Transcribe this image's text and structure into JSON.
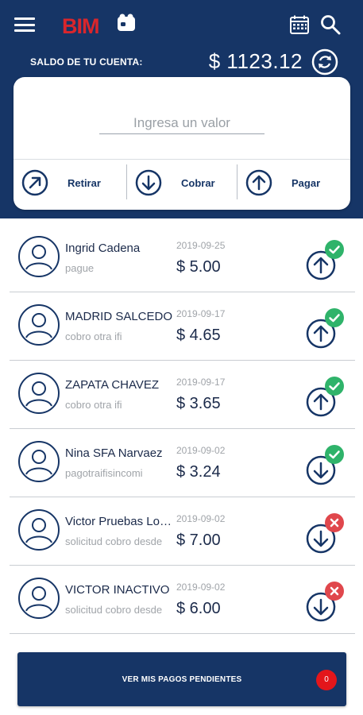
{
  "header": {
    "logo_text": "BIM",
    "balance_label": "SALDO DE TU CUENTA:",
    "balance_value": "$ 1123.12"
  },
  "card": {
    "input_placeholder": "Ingresa un valor",
    "actions": [
      {
        "label": "Retirar",
        "icon": "arrow-up-right-circle-icon"
      },
      {
        "label": "Cobrar",
        "icon": "arrow-down-circle-icon"
      },
      {
        "label": "Pagar",
        "icon": "arrow-up-circle-icon"
      }
    ]
  },
  "transactions": [
    {
      "name": "Ingrid Cadena",
      "description": "pague",
      "date": "2019-09-25",
      "amount": "$ 5.00",
      "direction": "up",
      "status": "success"
    },
    {
      "name": "MADRID SALCEDO",
      "description": "cobro otra ifi",
      "date": "2019-09-17",
      "amount": "$ 4.65",
      "direction": "up",
      "status": "success"
    },
    {
      "name": "ZAPATA CHAVEZ",
      "description": "cobro otra ifi",
      "date": "2019-09-17",
      "amount": "$ 3.65",
      "direction": "up",
      "status": "success"
    },
    {
      "name": "Nina SFA Narvaez",
      "description": "pagotraifisincomi",
      "date": "2019-09-02",
      "amount": "$ 3.24",
      "direction": "down",
      "status": "success"
    },
    {
      "name": "Victor Pruebas Lopez",
      "description": "solicitud cobro desde",
      "date": "2019-09-02",
      "amount": "$ 7.00",
      "direction": "down",
      "status": "failed"
    },
    {
      "name": "VICTOR INACTIVO",
      "description": "solicitud cobro desde",
      "date": "2019-09-02",
      "amount": "$ 6.00",
      "direction": "down",
      "status": "failed"
    }
  ],
  "footer": {
    "pending_label": "VER MIS PAGOS PENDIENTES",
    "pending_count": "0"
  },
  "colors": {
    "primary": "#163566",
    "success": "#2fb36a",
    "error": "#e0474c",
    "badge": "#e3161b",
    "logo_red": "#d9262c"
  }
}
